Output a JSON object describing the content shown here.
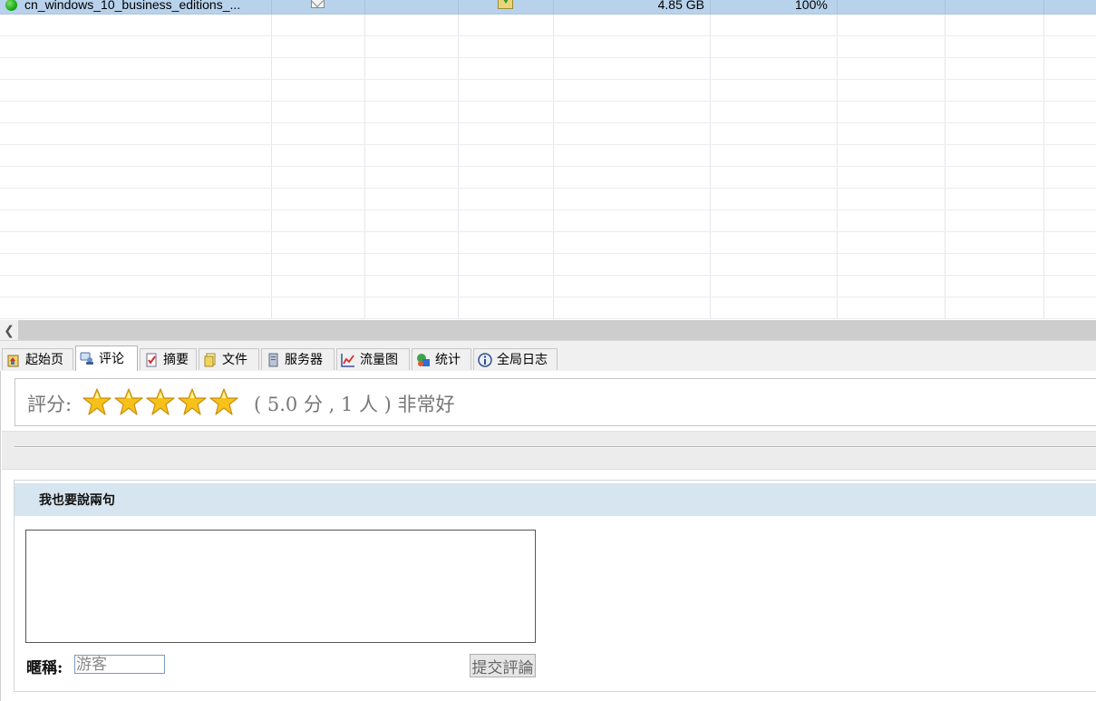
{
  "file_list": {
    "selected_row": {
      "status_icon": "green-dot-icon",
      "name": "cn_windows_10_business_editions_...",
      "comment_icon": "envelope-icon",
      "type_icon": "download-folder-icon",
      "size": "4.85 GB",
      "progress": "100%"
    },
    "selected_color": "#b8d2ec"
  },
  "tabs": [
    {
      "label": "起始页",
      "icon": "home-page-icon"
    },
    {
      "label": "评论",
      "icon": "comments-icon",
      "active": true
    },
    {
      "label": "摘要",
      "icon": "summary-checklist-icon"
    },
    {
      "label": "文件",
      "icon": "files-folder-icon"
    },
    {
      "label": "服务器",
      "icon": "server-icon"
    },
    {
      "label": "流量图",
      "icon": "traffic-chart-icon"
    },
    {
      "label": "统计",
      "icon": "statistics-icon"
    },
    {
      "label": "全局日志",
      "icon": "info-log-icon"
    }
  ],
  "rating": {
    "label": "評分:",
    "stars": 5,
    "star_color": "#f6c21a",
    "summary": "( 5.0 分 , 1 人 ) 非常好"
  },
  "comment_form": {
    "title": "我也要說兩句",
    "textarea_value": "",
    "nickname_label": "暱稱:",
    "nickname_placeholder": "游客",
    "submit_label": "提交評論",
    "header_color": "#d6e5ef"
  }
}
